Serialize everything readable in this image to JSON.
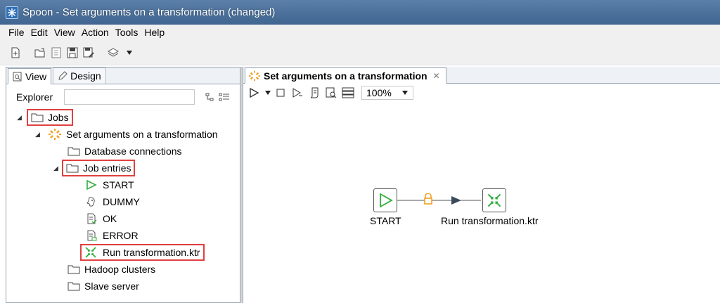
{
  "window": {
    "title": "Spoon - Set arguments on a transformation (changed)"
  },
  "menu": [
    "File",
    "Edit",
    "View",
    "Action",
    "Tools",
    "Help"
  ],
  "left_panel": {
    "tabs": [
      {
        "label": "View"
      },
      {
        "label": "Design"
      }
    ],
    "explorer_label": "Explorer",
    "explorer_filter_value": "",
    "tree": {
      "jobs": "Jobs",
      "job_name": "Set arguments on a transformation",
      "database_connections": "Database connections",
      "job_entries": "Job entries",
      "entries": [
        {
          "label": "START",
          "icon": "start-icon"
        },
        {
          "label": "DUMMY",
          "icon": "dummy-icon"
        },
        {
          "label": "OK",
          "icon": "ok-icon"
        },
        {
          "label": "ERROR",
          "icon": "error-icon"
        },
        {
          "label": "Run transformation.ktr",
          "icon": "transformation-icon"
        }
      ],
      "hadoop_clusters": "Hadoop clusters",
      "slave_server": "Slave server"
    }
  },
  "editor": {
    "tab_label": "Set arguments on a transformation",
    "zoom": "100%",
    "nodes": [
      {
        "label": "START",
        "icon": "start-icon"
      },
      {
        "label": "Run transformation.ktr",
        "icon": "transformation-icon"
      }
    ]
  },
  "colors": {
    "highlight_box": "#e04040",
    "start_green": "#2fae3a",
    "lock_orange": "#f0a020"
  }
}
